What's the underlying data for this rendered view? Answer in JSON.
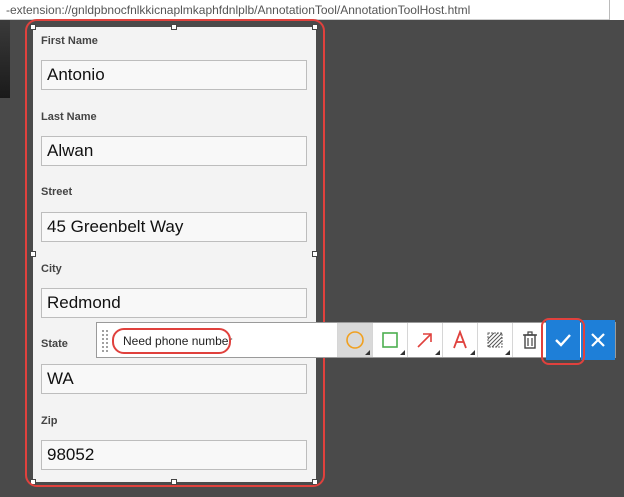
{
  "address_bar": {
    "url": "-extension://gnldpbnocfnlkkicnaplmkaphfdnlplb/AnnotationTool/AnnotationToolHost.html"
  },
  "form": {
    "fields": [
      {
        "label": "First Name",
        "value": "Antonio"
      },
      {
        "label": "Last Name",
        "value": "Alwan"
      },
      {
        "label": "Street",
        "value": "45 Greenbelt Way"
      },
      {
        "label": "City",
        "value": "Redmond"
      },
      {
        "label": "State",
        "value": "WA"
      },
      {
        "label": "Zip",
        "value": "98052"
      }
    ]
  },
  "toolbar": {
    "note_text": "Need phone number",
    "tools": [
      {
        "name": "ellipse-tool",
        "icon": "circle-icon",
        "color": "#f0a020"
      },
      {
        "name": "rectangle-tool",
        "icon": "square-icon",
        "color": "#4caf50"
      },
      {
        "name": "arrow-tool",
        "icon": "arrow-icon",
        "color": "#e0413d"
      },
      {
        "name": "text-tool",
        "icon": "text-a-icon",
        "color": "#e0413d"
      },
      {
        "name": "blur-tool",
        "icon": "hatch-icon",
        "color": "#555555"
      },
      {
        "name": "delete-tool",
        "icon": "trash-icon",
        "color": "#444444"
      }
    ],
    "confirm_icon": "checkmark-icon",
    "cancel_icon": "close-icon"
  },
  "colors": {
    "highlight": "#e0413d",
    "button_blue": "#1e7fd8",
    "background": "#4a4a4a"
  }
}
